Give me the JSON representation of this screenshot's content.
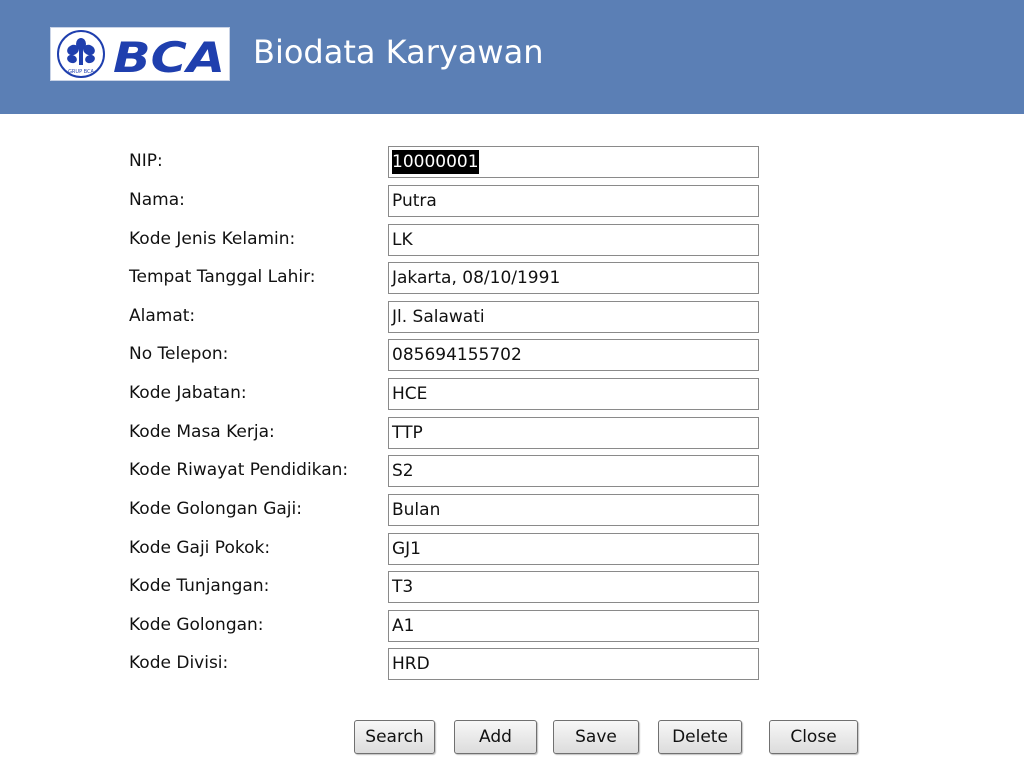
{
  "header": {
    "logo_text": "BCA",
    "logo_subtext": "GRUP BCA",
    "title": "Biodata Karyawan",
    "background_color": "#5b7fb5",
    "logo_color": "#1f3fae"
  },
  "form": {
    "fields": [
      {
        "label": "NIP:",
        "value": "10000001",
        "selected": true
      },
      {
        "label": "Nama:",
        "value": "Putra"
      },
      {
        "label": "Kode Jenis Kelamin:",
        "value": "LK"
      },
      {
        "label": "Tempat Tanggal Lahir:",
        "value": "Jakarta, 08/10/1991"
      },
      {
        "label": "Alamat:",
        "value": "Jl. Salawati"
      },
      {
        "label": "No Telepon:",
        "value": "085694155702"
      },
      {
        "label": "Kode Jabatan:",
        "value": "HCE"
      },
      {
        "label": "Kode Masa Kerja:",
        "value": "TTP"
      },
      {
        "label": "Kode Riwayat Pendidikan:",
        "value": "S2"
      },
      {
        "label": "Kode Golongan Gaji:",
        "value": "Bulan"
      },
      {
        "label": "Kode Gaji Pokok:",
        "value": "GJ1"
      },
      {
        "label": "Kode Tunjangan:",
        "value": "T3"
      },
      {
        "label": "Kode Golongan:",
        "value": "A1"
      },
      {
        "label": "Kode Divisi:",
        "value": "HRD"
      }
    ]
  },
  "buttons": {
    "search": "Search",
    "add": "Add",
    "save": "Save",
    "delete": "Delete",
    "close": "Close"
  }
}
